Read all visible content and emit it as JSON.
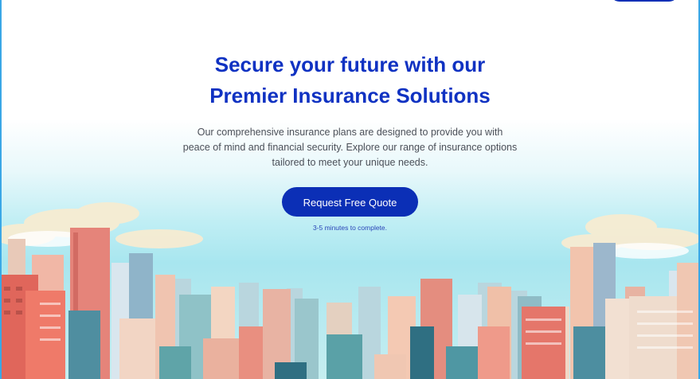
{
  "hero": {
    "title_line1": "Secure your future with our",
    "title_line2": "Premier Insurance Solutions",
    "description": "Our comprehensive insurance plans are designed to provide you with peace of mind and financial security. Explore our range of insurance options tailored to meet your unique needs.",
    "cta_label": "Request Free Quote",
    "cta_hint": "3-5 minutes to complete."
  },
  "colors": {
    "brand_blue": "#1032c2",
    "button_blue": "#0b2fb6",
    "frame_blue": "#3aa7e6"
  },
  "illustration": {
    "name": "city-skyline-illustration"
  }
}
